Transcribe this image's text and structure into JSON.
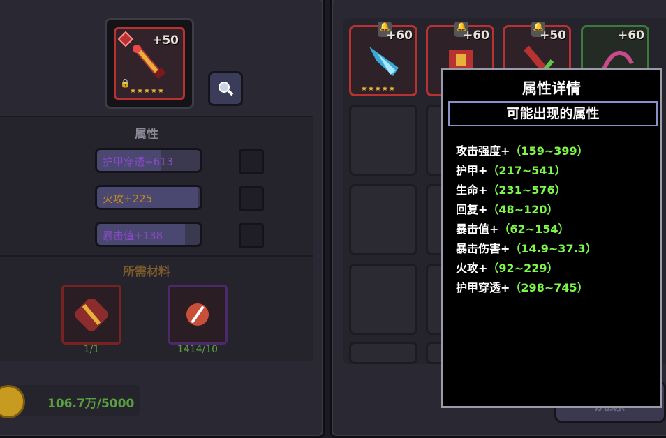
{
  "item": {
    "plus": "+50",
    "stars": "★★★★★"
  },
  "attributes": {
    "title": "属性",
    "rows": [
      {
        "text": "护甲穿透+613",
        "color": "purple",
        "fill_pct": 0.62
      },
      {
        "text": "火攻+225",
        "color": "orange",
        "fill_pct": 0.98
      },
      {
        "text": "暴击值+138",
        "color": "purple",
        "fill_pct": 0.85
      }
    ]
  },
  "materials": {
    "title": "所需材料",
    "items": [
      {
        "count": "1/1",
        "icon": "scepter-icon"
      },
      {
        "count": "1414/10",
        "icon": "stone-icon"
      }
    ]
  },
  "gold": {
    "text": "106.7万/5000"
  },
  "inventory": {
    "items": [
      {
        "plus": "+60",
        "stars": "★★★★★",
        "icon": "crystal-staff-icon"
      },
      {
        "plus": "+60",
        "stars": "★★★★★",
        "icon": "armor-icon"
      },
      {
        "plus": "+50",
        "stars": "★★★★★",
        "icon": "scepter-icon"
      },
      {
        "plus": "+60",
        "stars": "★★★★★",
        "icon": "claw-icon"
      }
    ]
  },
  "refine_button": {
    "label": "洗练"
  },
  "tooltip": {
    "title": "属性详情",
    "subtitle": "可能出现的属性",
    "rows": [
      {
        "name": "攻击强度+",
        "range": "（159~399）"
      },
      {
        "name": "护甲+",
        "range": "（217~541）"
      },
      {
        "name": "生命+",
        "range": "（231~576）"
      },
      {
        "name": "回复+",
        "range": "（48~120）"
      },
      {
        "name": "暴击值+",
        "range": "（62~154）"
      },
      {
        "name": "暴击伤害+",
        "range": "（14.9~37.3）"
      },
      {
        "name": "火攻+",
        "range": "（92~229）"
      },
      {
        "name": "护甲穿透+",
        "range": "（298~745）"
      }
    ]
  },
  "colors": {
    "accent_red": "#b83232",
    "range_green": "#7cf84a",
    "count_green": "#5aa040"
  }
}
